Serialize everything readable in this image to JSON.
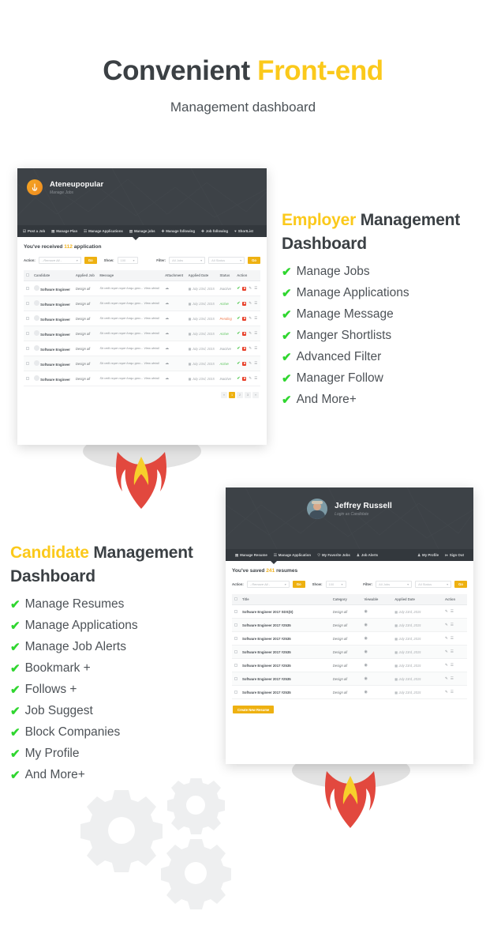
{
  "hero": {
    "title_plain": "Convenient ",
    "title_accent": "Front-end",
    "subtitle": "Management dashboard"
  },
  "colors": {
    "accent_yellow": "#fbc91b",
    "check_green": "#2fd62f",
    "dark_panel": "#3d4247",
    "nav_panel": "#33383d",
    "button_yellow": "#eeb111",
    "flame_red": "#e2483e",
    "flame_yellow": "#f7cf2b"
  },
  "employer_block": {
    "title_accent": "Employer",
    "title_plain": " Management Dashboard",
    "features": [
      "Manage Jobs",
      "Manage Applications",
      "Manage Message",
      "Manger Shortlists",
      "Advanced Filter",
      "Manager Follow",
      "And More+"
    ]
  },
  "candidate_block": {
    "title_accent": "Candidate",
    "title_plain": " Management Dashboard",
    "features": [
      "Manage Resumes",
      "Manage Applications",
      "Manage Job Alerts",
      "Bookmark +",
      "Follows +",
      "Job Suggest",
      "Block Companies",
      "My Profile",
      "And More+"
    ]
  },
  "employer_mock": {
    "brand_name": "Ateneupopular",
    "brand_sub": "Manage Jobs",
    "nav": [
      {
        "icon": "edit-icon",
        "glyph": "☑",
        "label": "Post a Job"
      },
      {
        "icon": "document-icon",
        "glyph": "▤",
        "label": "Manage Plan"
      },
      {
        "icon": "grid-icon",
        "glyph": "☷",
        "label": "Manage Applications"
      },
      {
        "icon": "briefcase-icon",
        "glyph": "▧",
        "label": "Manage jobs"
      },
      {
        "icon": "plus-icon",
        "glyph": "✚",
        "label": "Manage  following"
      },
      {
        "icon": "plus-icon",
        "glyph": "✚",
        "label": "Job  following"
      },
      {
        "icon": "heart-icon",
        "glyph": "♥",
        "label": "ShortList"
      }
    ],
    "headline_pre": "You've received ",
    "headline_num": "112",
    "headline_post": " application",
    "controls": {
      "action_label": "Action:",
      "action_value": "- Remove All -",
      "go_label": "Go",
      "show_label": "Show:",
      "show_value": "100",
      "filter_label": "Filter:",
      "filter_jobs": "All Jobs",
      "filter_status": "All Status",
      "go2_label": "Go"
    },
    "columns": [
      "",
      "Candidate",
      "Applied Job",
      "Message",
      "Attachment",
      "Applied Date",
      "Status",
      "Action"
    ],
    "rows": [
      {
        "candidate": "Software Engineer",
        "job": "Design all",
        "message": "Sit velit nope nope furqu gmv...",
        "link": "View detail",
        "date": "July 23rd, 2015",
        "status": "Inactive"
      },
      {
        "candidate": "Software Engineer",
        "job": "Design all",
        "message": "Sit velit nope nope furqu gmv...",
        "link": "View detail",
        "date": "July 23rd, 2015",
        "status": "Active"
      },
      {
        "candidate": "Software Engineer",
        "job": "Design all",
        "message": "Sit velit nope nope furqu gmv...",
        "link": "View detail",
        "date": "July 23rd, 2015",
        "status": "Pending"
      },
      {
        "candidate": "Software Engineer",
        "job": "Design all",
        "message": "Sit velit nope nope furqu gmv...",
        "link": "View detail",
        "date": "July 23rd, 2015",
        "status": "Active"
      },
      {
        "candidate": "Software Engineer",
        "job": "Design all",
        "message": "Sit velit nope nope furqu gmv...",
        "link": "View detail",
        "date": "July 23rd, 2015",
        "status": "Inactive"
      },
      {
        "candidate": "Software Engineer",
        "job": "Design all",
        "message": "Sit velit nope nope furqu gmv...",
        "link": "View detail",
        "date": "July 23rd, 2015",
        "status": "Active"
      },
      {
        "candidate": "Software Engineer",
        "job": "Design all",
        "message": "Sit velit nope nope furqu gmv...",
        "link": "View detail",
        "date": "July 23rd, 2015",
        "status": "Inactive"
      }
    ],
    "pagination": [
      "«",
      "1",
      "2",
      "3",
      "»"
    ],
    "pagination_active": "1"
  },
  "candidate_mock": {
    "user_name": "Jeffrey Russell",
    "user_sub": "Login as Candidate",
    "nav": [
      {
        "icon": "document-icon",
        "glyph": "▤",
        "label": "Manage Resume"
      },
      {
        "icon": "grid-icon",
        "glyph": "☷",
        "label": "Manage Application"
      },
      {
        "icon": "heart-icon",
        "glyph": "♡",
        "label": "My Favorite Jobs"
      },
      {
        "icon": "bell-icon",
        "glyph": "♟",
        "label": "Job Alerts"
      }
    ],
    "nav_right": [
      {
        "icon": "user-icon",
        "glyph": "♟",
        "label": "My Profile"
      },
      {
        "icon": "signout-icon",
        "glyph": "↦",
        "label": "Sign Out"
      }
    ],
    "headline_pre": "You've saved ",
    "headline_num": "241",
    "headline_post": " resumes",
    "controls": {
      "action_label": "Action:",
      "action_value": "- Remove All -",
      "go_label": "Go",
      "show_label": "Show:",
      "show_value": "100",
      "filter_label": "Filter:",
      "filter_jobs": "All Jobs",
      "filter_status": "All Status",
      "go2_label": "Go"
    },
    "columns": [
      "",
      "Title",
      "Category",
      "Viewable",
      "Applied Date",
      "Action"
    ],
    "rows": [
      {
        "title": "Software Engineer 2017 SDS(D)",
        "category": "Design all",
        "date": "July 23rd, 2015"
      },
      {
        "title": "Software Engineer 2017 #2535",
        "category": "Design all",
        "date": "July 23rd, 2015"
      },
      {
        "title": "Software Engineer 2017 #2535",
        "category": "Design all",
        "date": "July 23rd, 2015"
      },
      {
        "title": "Software Engineer 2017 #2535",
        "category": "Design all",
        "date": "July 23rd, 2015"
      },
      {
        "title": "Software Engineer 2017 #2535",
        "category": "Design all",
        "date": "July 23rd, 2015"
      },
      {
        "title": "Software Engineer 2017 #2535",
        "category": "Design all",
        "date": "July 23rd, 2015"
      },
      {
        "title": "Software Engineer 2017 #2535",
        "category": "Design all",
        "date": "July 23rd, 2015"
      }
    ],
    "create_button": "Create New Resume"
  }
}
